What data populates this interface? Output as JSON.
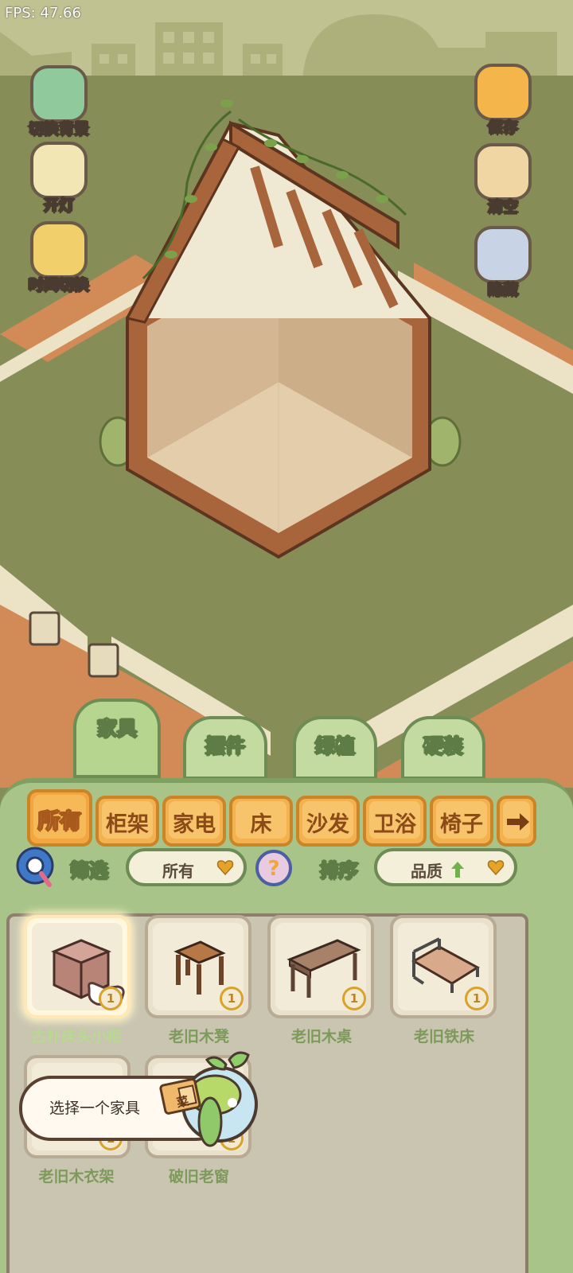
{
  "hud": {
    "fps": "FPS: 47.66"
  },
  "left_buttons": [
    {
      "label": "切换背景",
      "icon": "background-icon"
    },
    {
      "label": "开灯",
      "icon": "lamp-icon"
    },
    {
      "label": "时间切换",
      "icon": "sun-moon-icon"
    }
  ],
  "right_buttons": [
    {
      "label": "保存",
      "icon": "save-icon"
    },
    {
      "label": "清空",
      "icon": "clear-icon"
    },
    {
      "label": "隐藏",
      "icon": "hide-icon"
    }
  ],
  "category_tabs": [
    "家具",
    "摆件",
    "绿植",
    "硬装"
  ],
  "active_category": "家具",
  "sub_tabs": [
    "所有",
    "柜架",
    "家电",
    "床",
    "沙发",
    "卫浴",
    "椅子"
  ],
  "active_sub_tab": "所有",
  "filter": {
    "label": "筛选",
    "value": "所有"
  },
  "sort": {
    "label": "排序",
    "value": "品质",
    "direction": "up"
  },
  "items": [
    {
      "name": "古朴床头小柜",
      "count": "1",
      "selected": true
    },
    {
      "name": "老旧木凳",
      "count": "1"
    },
    {
      "name": "老旧木桌",
      "count": "1"
    },
    {
      "name": "老旧铁床",
      "count": "1"
    },
    {
      "name": "老旧木衣架",
      "count": "1"
    },
    {
      "name": "破旧老窗",
      "count": "1"
    }
  ],
  "tooltip": {
    "text": "选择一个家具",
    "book_label": "菜"
  },
  "colors": {
    "ground": "#868d57",
    "panel": "#a9c489",
    "tab_orange": "#f3b24f",
    "wood": "#a8643a"
  }
}
